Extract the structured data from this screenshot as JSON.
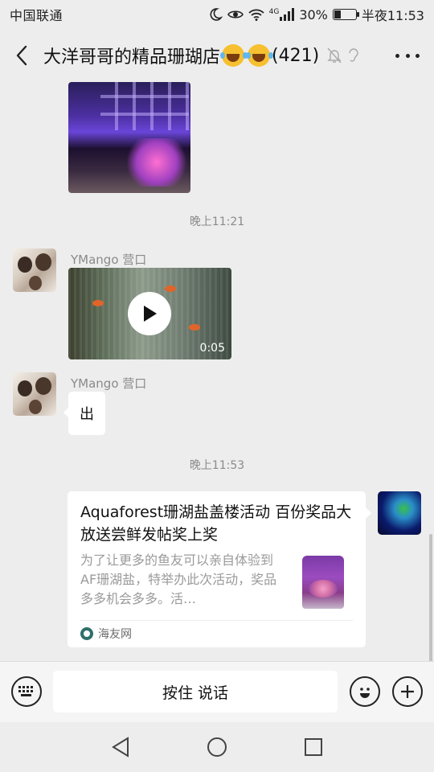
{
  "status_bar": {
    "carrier": "中国联通",
    "network": "4G",
    "battery": "30%",
    "time": "半夜11:53"
  },
  "header": {
    "title": "大洋哥哥的精品珊瑚店",
    "member_count": "(421)",
    "icons": [
      "back-arrow-icon",
      "mute-bell-icon",
      "ear-icon",
      "more-icon"
    ]
  },
  "messages": {
    "time_1": "晚上11:21",
    "sender_1": "YMango 营口",
    "video_duration": "0:05",
    "sender_2": "YMango 营口",
    "text_2": "出",
    "time_2": "晚上11:53",
    "link_card": {
      "title": "Aquaforest珊湖盐盖楼活动 百份奖品大放送尝鲜发帖奖上奖",
      "description": "为了让更多的鱼友可以亲自体验到AF珊湖盐，特举办此次活动，奖品多多机会多多。活…",
      "source": "海友网"
    }
  },
  "input_bar": {
    "hold_to_talk": "按住 说话",
    "icons": [
      "keyboard-icon",
      "emoji-icon",
      "plus-icon"
    ]
  },
  "nav_bar": {
    "icons": [
      "back-triangle-icon",
      "home-circle-icon",
      "recents-square-icon"
    ]
  },
  "colors": {
    "background": "#ededed",
    "bubble": "#ffffff",
    "muted_text": "#8a8a8a"
  }
}
